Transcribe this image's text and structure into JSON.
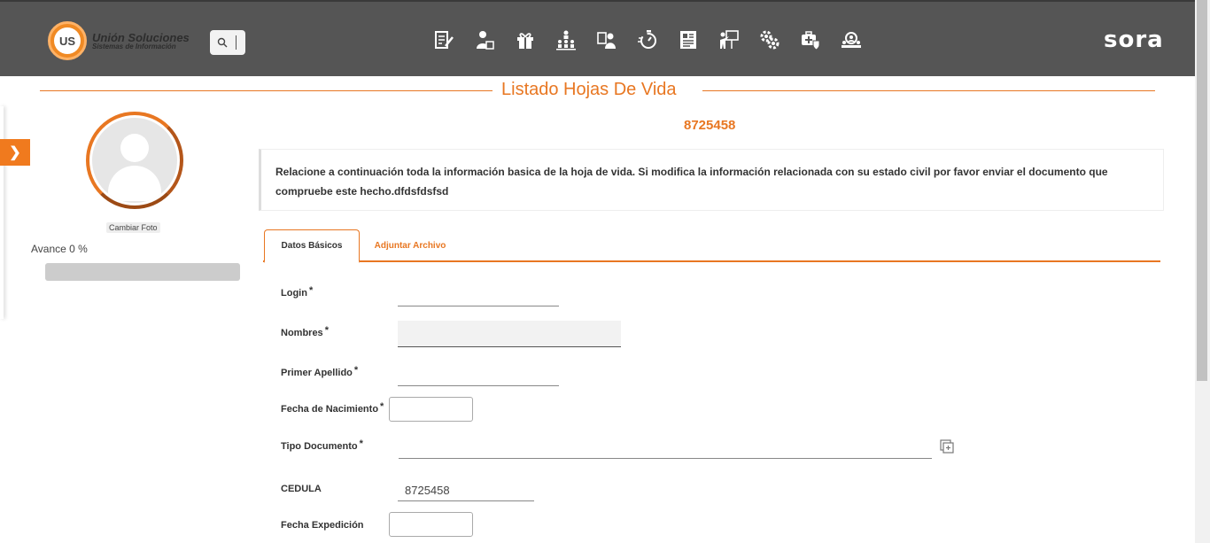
{
  "header": {
    "logo_initials": "US",
    "logo_line1": "Unión Soluciones",
    "logo_line2": "Sistemas de Información",
    "brand": "sora",
    "nav_icons": [
      "resume-edit-icon",
      "user-document-icon",
      "gift-icon",
      "hierarchy-icon",
      "employee-card-icon",
      "timer-icon",
      "report-icon",
      "training-icon",
      "gears-icon",
      "health-security-icon",
      "group-search-icon"
    ]
  },
  "page": {
    "title": "Listado Hojas De Vida",
    "document_number": "8725458",
    "info_text": "Relacione a continuación toda la información basica de la hoja de vida. Si modifica la información relacionada con su estado civil por favor enviar el documento que compruebe este hecho.dfdsfdsfsd"
  },
  "profile": {
    "change_photo": "Cambiar Foto",
    "progress_label": "Avance 0 %",
    "progress_value": 0
  },
  "tabs": [
    {
      "label": "Datos Básicos",
      "active": true
    },
    {
      "label": "Adjuntar Archivo",
      "active": false
    }
  ],
  "form": {
    "required_mark": "*",
    "login_label": "Login",
    "login_value": "",
    "nombres_label": "Nombres",
    "nombres_value": "",
    "primer_apellido_label": "Primer Apellido",
    "primer_apellido_value": "",
    "fecha_nacimiento_label": "Fecha de Nacimiento",
    "fecha_nacimiento_value": "",
    "tipo_documento_label": "Tipo Documento",
    "tipo_documento_value": "",
    "cedula_label": "CEDULA",
    "cedula_value": "8725458",
    "fecha_expedicion_label": "Fecha Expedición",
    "fecha_expedicion_value": ""
  },
  "colors": {
    "accent": "#e87722",
    "topbar": "#555555"
  }
}
